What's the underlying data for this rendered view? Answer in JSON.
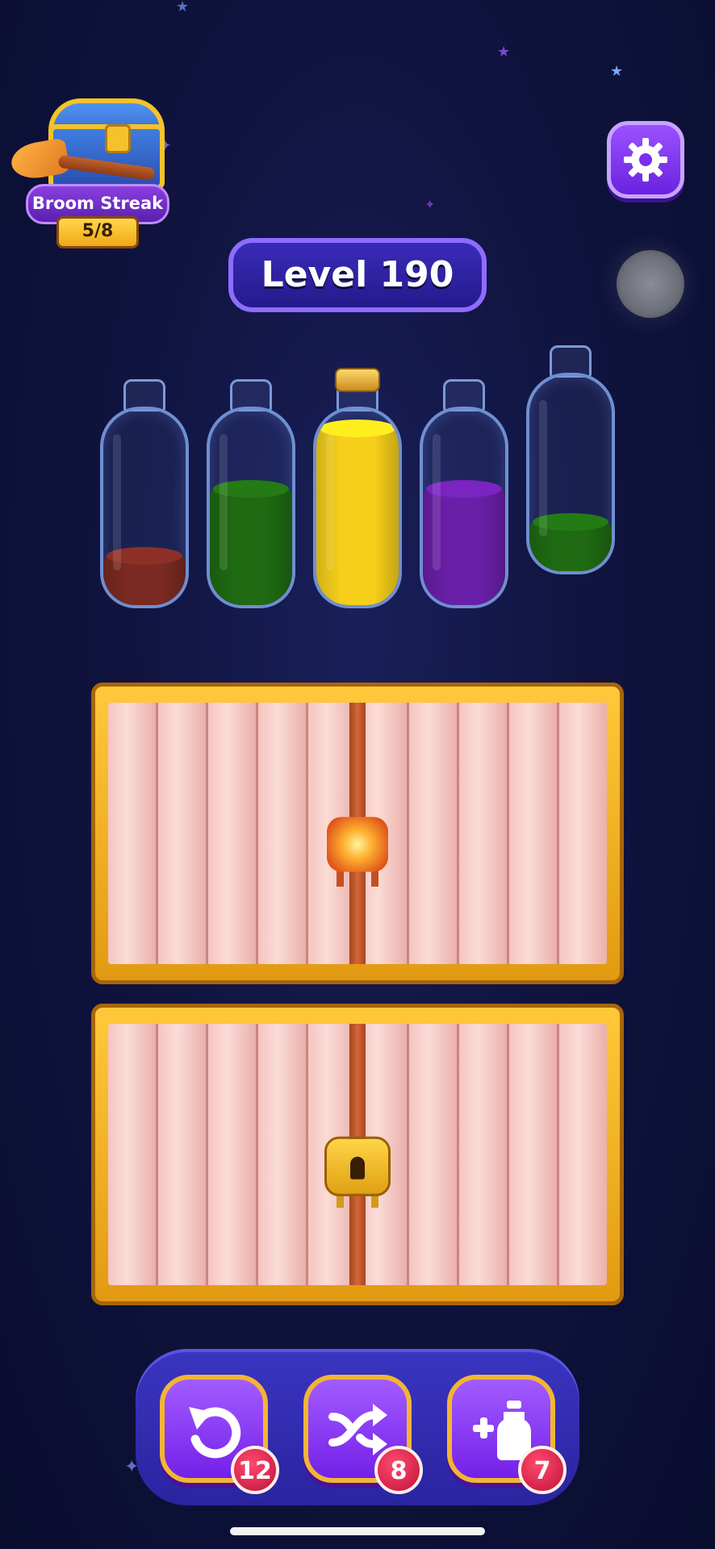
{
  "streak": {
    "label": "Broom Streak",
    "progress": "5/8"
  },
  "level": {
    "label": "Level 190"
  },
  "bottles": [
    {
      "liquid_color": "#7a2a22",
      "fill_fraction": 0.28,
      "corked": false
    },
    {
      "liquid_color": "#1f6a12",
      "fill_fraction": 0.66,
      "corked": false
    },
    {
      "liquid_color": "#f6cf1a",
      "fill_fraction": 1.0,
      "corked": true
    },
    {
      "liquid_color": "#6a1fa8",
      "fill_fraction": 0.66,
      "corked": false
    },
    {
      "liquid_color": "#1f6a12",
      "fill_fraction": 0.28,
      "corked": false
    }
  ],
  "shelves": [
    {
      "state": "locked",
      "lock_style": "fire"
    },
    {
      "state": "locked",
      "lock_style": "gold"
    }
  ],
  "powerups": {
    "undo": {
      "icon": "undo-icon",
      "count": "12"
    },
    "shuffle": {
      "icon": "shuffle-icon",
      "count": "8"
    },
    "add_bottle": {
      "icon": "add-bottle-icon",
      "count": "7"
    }
  },
  "colors": {
    "accent": "#8e6cff",
    "gold": "#f3b534",
    "badge": "#c0123a"
  }
}
